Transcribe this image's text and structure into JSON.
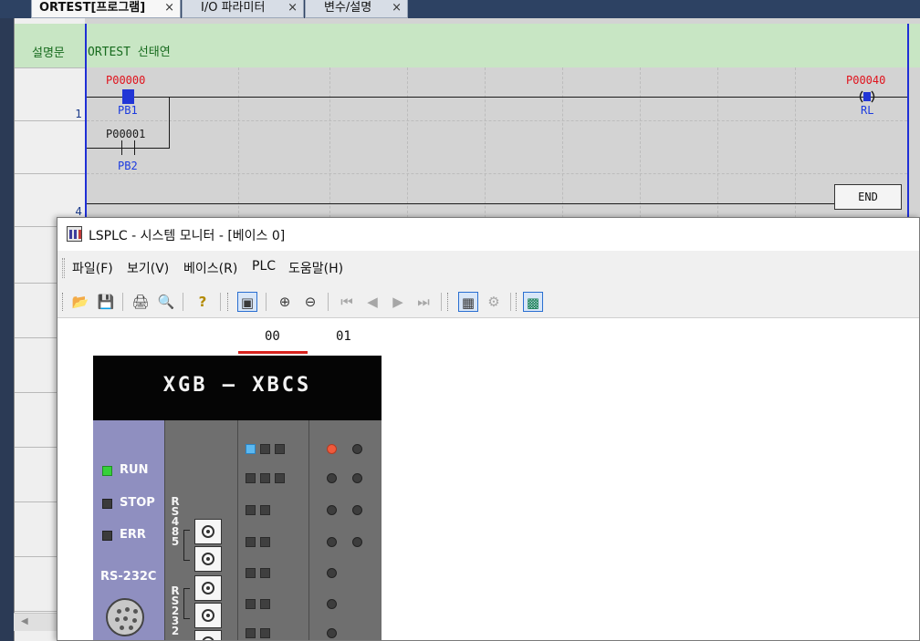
{
  "tabs": [
    {
      "label": "ORTEST[프로그램]",
      "close": "×",
      "active": true
    },
    {
      "label": "I/O 파라미터",
      "close": "×",
      "active": false
    },
    {
      "label": "변수/설명",
      "close": "×",
      "active": false
    }
  ],
  "ladder": {
    "comment_label": "설명문",
    "comment_text": "ORTEST 선태연",
    "row_numbers": [
      "1",
      "4"
    ],
    "contacts": [
      {
        "device": "P00000",
        "var": "PB1",
        "state": "on"
      },
      {
        "device": "P00001",
        "var": "PB2",
        "state": "off"
      }
    ],
    "coil": {
      "device": "P00040",
      "var": "RL",
      "state": "on"
    },
    "end_label": "END"
  },
  "monitor": {
    "title": "LSPLC - 시스템 모니터 - [베이스 0]",
    "menu": [
      "파일(F)",
      "보기(V)",
      "베이스(R)",
      "PLC",
      "도움말(H)"
    ],
    "toolbar": [
      {
        "icon": "open-folder-icon"
      },
      {
        "icon": "save-icon"
      },
      {
        "icon": "print-icon"
      },
      {
        "icon": "print-preview-icon"
      },
      {
        "icon": "help-icon"
      },
      {
        "icon": "monitor-view-icon"
      },
      {
        "icon": "zoom-in-icon"
      },
      {
        "icon": "zoom-out-icon"
      },
      {
        "icon": "first-icon"
      },
      {
        "icon": "previous-icon"
      },
      {
        "icon": "next-icon"
      },
      {
        "icon": "last-icon"
      },
      {
        "icon": "system-view-icon"
      },
      {
        "icon": "diagnosis-icon"
      },
      {
        "icon": "module-monitor-icon"
      }
    ],
    "slots": [
      "00",
      "01"
    ],
    "selected_slot": "00",
    "plc": {
      "model": "XGB — XBCS",
      "status": [
        {
          "label": "RUN",
          "led": "on",
          "color": "#36d13a"
        },
        {
          "label": "STOP",
          "led": "off"
        },
        {
          "label": "ERR",
          "led": "off"
        }
      ],
      "port_rs485": "RS485",
      "port_rs232": "RS232",
      "rs232c_label": "RS-232C"
    }
  }
}
